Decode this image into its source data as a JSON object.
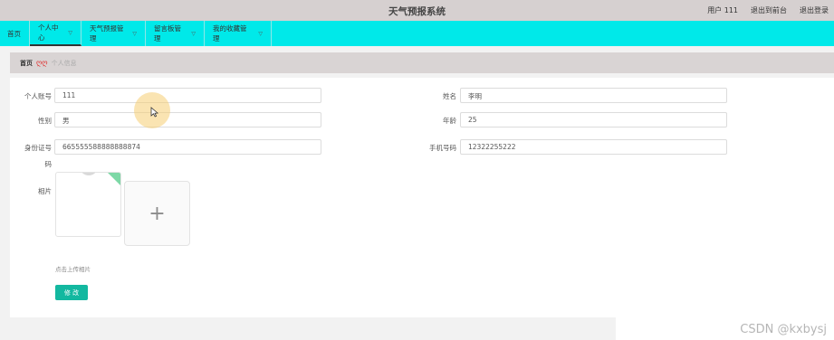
{
  "header": {
    "title": "天气预报系统",
    "user": "用户 111",
    "back_to_admin": "退出到前台",
    "logout": "退出登录"
  },
  "nav": {
    "home": "首页",
    "personal": "个人中心",
    "weather": "天气预报管理",
    "board": "留言板管理",
    "favorites": "我的收藏管理"
  },
  "breadcrumb": {
    "home": "首页",
    "separator": "ღღ",
    "current": "个人信息"
  },
  "form": {
    "account_label": "个人账号",
    "account_value": "111",
    "name_label": "姓名",
    "name_value": "李明",
    "gender_label": "性别",
    "gender_value": "男",
    "age_label": "年龄",
    "age_value": "25",
    "id_label_line1": "身份证号",
    "id_label_line2": "码",
    "id_value": "665555588888888874",
    "phone_label": "手机号码",
    "phone_value": "12322255222",
    "photo_label": "相片",
    "upload_plus": "+",
    "upload_hint": "点击上传相片",
    "submit": "修 改"
  },
  "watermark": "CSDN @kxbysj",
  "colors": {
    "navbar": "#00e9e9",
    "topbar": "#d6d0d0",
    "button": "#13b8a0",
    "separator": "#e03030"
  }
}
